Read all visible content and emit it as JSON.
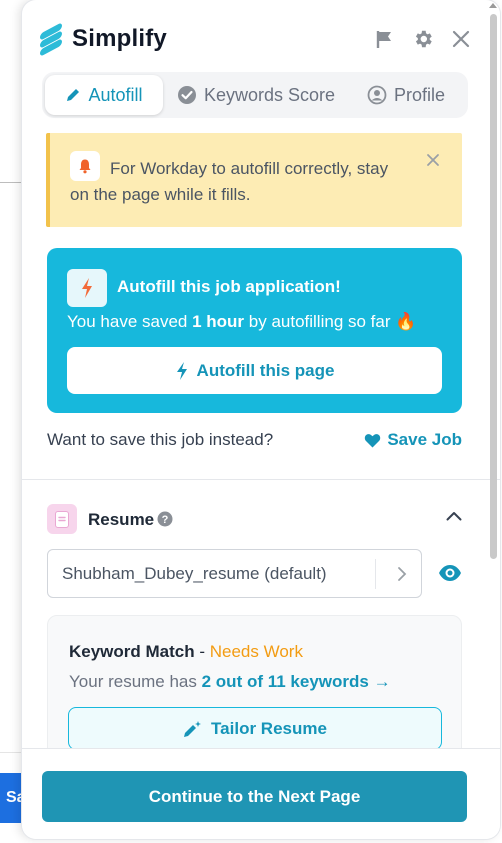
{
  "background_page": {
    "partial_button_label": "Sa"
  },
  "header": {
    "app_title": "Simplify",
    "icons": [
      "flag-icon",
      "gear-icon",
      "close-icon"
    ]
  },
  "tabs": [
    {
      "label": "Autofill",
      "icon": "pencil-icon",
      "active": true
    },
    {
      "label": "Keywords Score",
      "icon": "check-circle-icon",
      "active": false
    },
    {
      "label": "Profile",
      "icon": "user-circle-icon",
      "active": false
    }
  ],
  "alert": {
    "text": "For Workday to autofill correctly, stay on the page while it fills.",
    "icon": "bell-icon"
  },
  "autofill_card": {
    "title": "Autofill this job application!",
    "saved_prefix": "You have saved ",
    "saved_amount": "1 hour",
    "saved_suffix": " by autofilling so far",
    "saved_emoji": "🔥",
    "button_label": "Autofill this page"
  },
  "save_job": {
    "question": "Want to save this job instead?",
    "link_label": "Save Job"
  },
  "resume": {
    "section_label": "Resume",
    "selected_file": "Shubham_Dubey_resume (default)"
  },
  "keyword_match": {
    "title": "Keyword Match",
    "separator": " - ",
    "status": "Needs Work",
    "sub_prefix": "Your resume has ",
    "sub_link": "2 out of 11 keywords →",
    "tailor_button": "Tailor Resume"
  },
  "footer": {
    "continue_button": "Continue to the Next Page"
  },
  "colors": {
    "brand": "#17b8dc",
    "brand_dark": "#1f95b4",
    "alert_bg": "#fdecb4",
    "status_orange": "#f39c12"
  }
}
